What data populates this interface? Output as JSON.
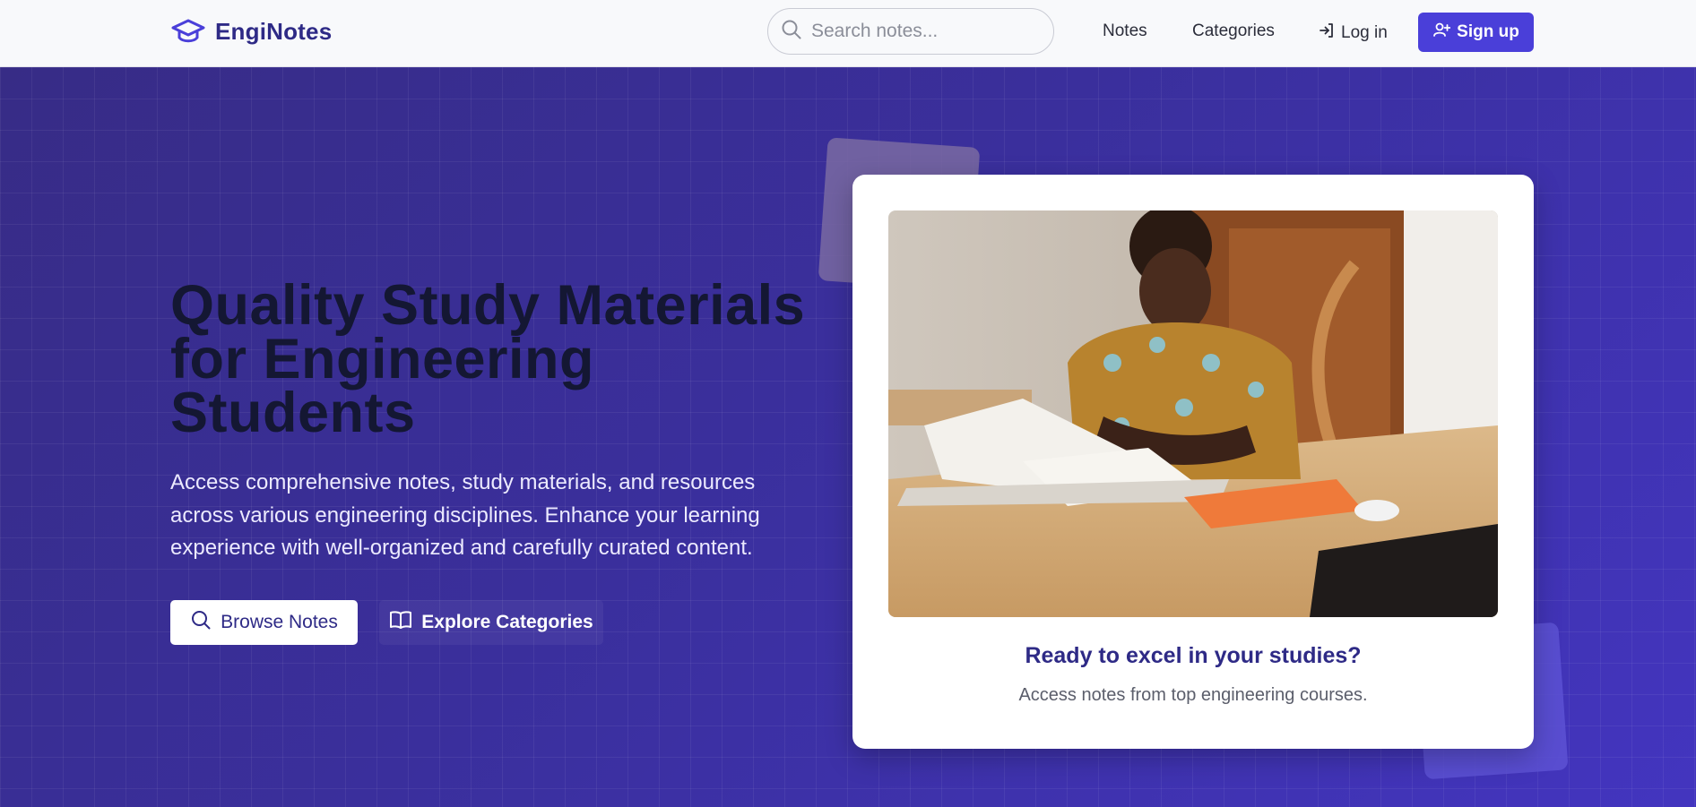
{
  "brand": {
    "name": "EngiNotes",
    "logo_icon": "graduation-cap-icon"
  },
  "search": {
    "placeholder": "Search notes...",
    "value": "",
    "icon": "search-icon"
  },
  "nav": {
    "notes_label": "Notes",
    "categories_label": "Categories",
    "login_label": "Log in",
    "login_icon": "log-in-icon",
    "signup_label": "Sign up",
    "signup_icon": "user-plus-icon"
  },
  "hero": {
    "headline_line1": "Quality Study Materials",
    "headline_line2": "for Engineering",
    "headline_line3": "Students",
    "subtext": "Access comprehensive notes, study materials, and resources across various engineering disciplines. Enhance your learning experience with well-organized and carefully curated content.",
    "browse_label": "Browse Notes",
    "browse_icon": "search-icon",
    "explore_label": "Explore Categories",
    "explore_icon": "open-book-icon"
  },
  "card": {
    "image_description": "student-reading-book-photo",
    "title": "Ready to excel in your studies?",
    "subtitle": "Access notes from top engineering courses."
  },
  "colors": {
    "brand": "#2e2a86",
    "accent": "#4a3fd9",
    "hero_bg": "#3a2f9c",
    "headline": "#141733"
  }
}
